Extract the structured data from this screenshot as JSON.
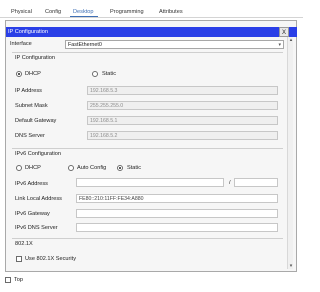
{
  "tabs": [
    "Physical",
    "Config",
    "Desktop",
    "Programming",
    "Attributes"
  ],
  "active_tab": "Desktop",
  "window_title": "IP Configuration",
  "close_label": "X",
  "interface": {
    "label": "Interface",
    "value": "FastEthernet0"
  },
  "ipconfig": {
    "section": "IP Configuration",
    "dhcp_label": "DHCP",
    "static_label": "Static",
    "ip_label": "IP Address",
    "ip_value": "192.168.5.3",
    "mask_label": "Subnet Mask",
    "mask_value": "255.255.255.0",
    "gw_label": "Default Gateway",
    "gw_value": "192.168.5.1",
    "dns_label": "DNS Server",
    "dns_value": "192.168.5.2"
  },
  "ipv6": {
    "section": "IPv6 Configuration",
    "dhcp_label": "DHCP",
    "auto_label": "Auto Config",
    "static_label": "Static",
    "addr_label": "IPv6 Address",
    "addr_value": "",
    "slash": "/",
    "prefix_value": "",
    "lla_label": "Link Local Address",
    "lla_value": "FE80::210:11FF:FE34:A880",
    "gw_label": "IPv6 Gateway",
    "gw_value": "",
    "dns_label": "IPv6 DNS Server",
    "dns_value": ""
  },
  "dot1x": {
    "section": "802.1X",
    "use_label": "Use 802.1X Security"
  },
  "bottom": {
    "top_label": "Top"
  },
  "colors": {
    "titlebar": "#2a3fe7",
    "active_tab": "#3f6fb5"
  }
}
